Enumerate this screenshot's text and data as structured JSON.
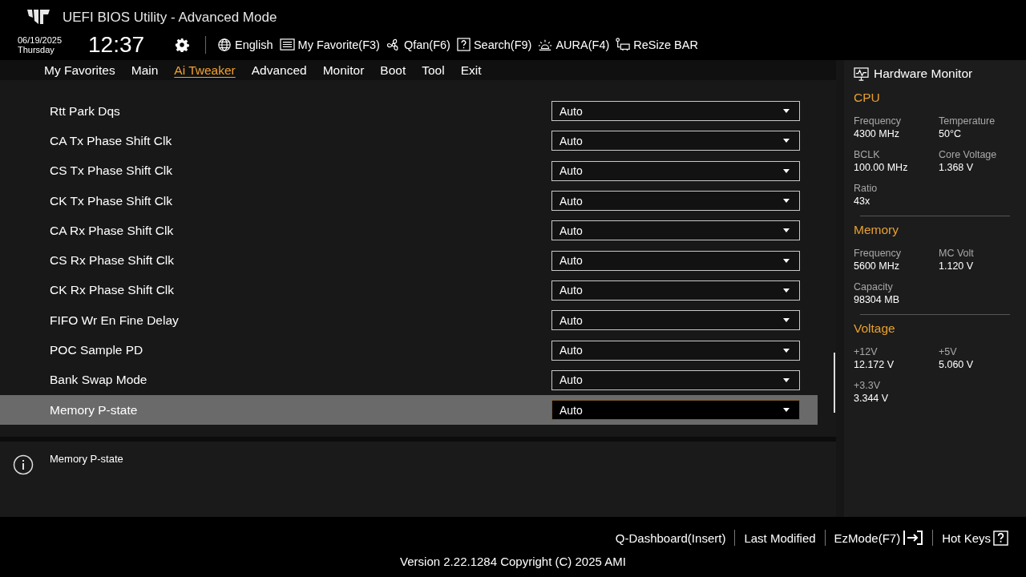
{
  "header": {
    "title": "UEFI BIOS Utility - Advanced Mode",
    "date": "06/19/2025",
    "day": "Thursday",
    "time": "12:37",
    "toolbar": [
      {
        "kind": "gear"
      },
      {
        "kind": "globe",
        "label": "English"
      },
      {
        "kind": "list",
        "label": "My Favorite(F3)"
      },
      {
        "kind": "fan",
        "label": "Qfan(F6)"
      },
      {
        "kind": "help",
        "label": "Search(F9)"
      },
      {
        "kind": "aura",
        "label": "AURA(F4)"
      },
      {
        "kind": "resize",
        "label": "ReSize BAR"
      }
    ]
  },
  "tabs": [
    {
      "label": "My Favorites",
      "selected": false
    },
    {
      "label": "Main",
      "selected": false
    },
    {
      "label": "Ai Tweaker",
      "selected": true
    },
    {
      "label": "Advanced",
      "selected": false
    },
    {
      "label": "Monitor",
      "selected": false
    },
    {
      "label": "Boot",
      "selected": false
    },
    {
      "label": "Tool",
      "selected": false
    },
    {
      "label": "Exit",
      "selected": false
    }
  ],
  "settings": [
    {
      "label": "Rtt Park Dqs",
      "value": "Auto",
      "selected": false
    },
    {
      "label": "CA Tx Phase Shift Clk",
      "value": "Auto",
      "selected": false
    },
    {
      "label": "CS Tx Phase Shift Clk",
      "value": "Auto",
      "selected": false
    },
    {
      "label": "CK Tx Phase Shift Clk",
      "value": "Auto",
      "selected": false
    },
    {
      "label": "CA Rx Phase Shift Clk",
      "value": "Auto",
      "selected": false
    },
    {
      "label": "CS Rx Phase Shift Clk",
      "value": "Auto",
      "selected": false
    },
    {
      "label": "CK Rx Phase Shift Clk",
      "value": "Auto",
      "selected": false
    },
    {
      "label": "FIFO Wr En Fine Delay",
      "value": "Auto",
      "selected": false
    },
    {
      "label": "POC Sample PD",
      "value": "Auto",
      "selected": false
    },
    {
      "label": "Bank Swap Mode",
      "value": "Auto",
      "selected": false
    },
    {
      "label": "Memory P-state",
      "value": "Auto",
      "selected": true
    }
  ],
  "help": {
    "text": "Memory P-state"
  },
  "monitor": {
    "title": "Hardware Monitor",
    "sections": [
      {
        "title": "CPU",
        "items": [
          {
            "label": "Frequency",
            "value": "4300 MHz"
          },
          {
            "label": "Temperature",
            "value": "50°C"
          },
          {
            "label": "BCLK",
            "value": "100.00 MHz"
          },
          {
            "label": "Core Voltage",
            "value": "1.368 V"
          },
          {
            "label": "Ratio",
            "value": "43x"
          }
        ]
      },
      {
        "title": "Memory",
        "items": [
          {
            "label": "Frequency",
            "value": "5600 MHz"
          },
          {
            "label": "MC Volt",
            "value": "1.120 V"
          },
          {
            "label": "Capacity",
            "value": "98304 MB"
          }
        ]
      },
      {
        "title": "Voltage",
        "items": [
          {
            "label": "+12V",
            "value": "12.172 V"
          },
          {
            "label": "+5V",
            "value": "5.060 V"
          },
          {
            "label": "+3.3V",
            "value": "3.344 V"
          }
        ]
      }
    ]
  },
  "footer": {
    "actions": [
      {
        "kind": "text",
        "label": "Q-Dashboard(Insert)"
      },
      {
        "kind": "text",
        "label": "Last Modified"
      },
      {
        "kind": "exit",
        "label": "EzMode(F7)"
      },
      {
        "kind": "help",
        "label": "Hot Keys"
      }
    ],
    "version": "Version 2.22.1284 Copyright (C) 2025 AMI"
  }
}
